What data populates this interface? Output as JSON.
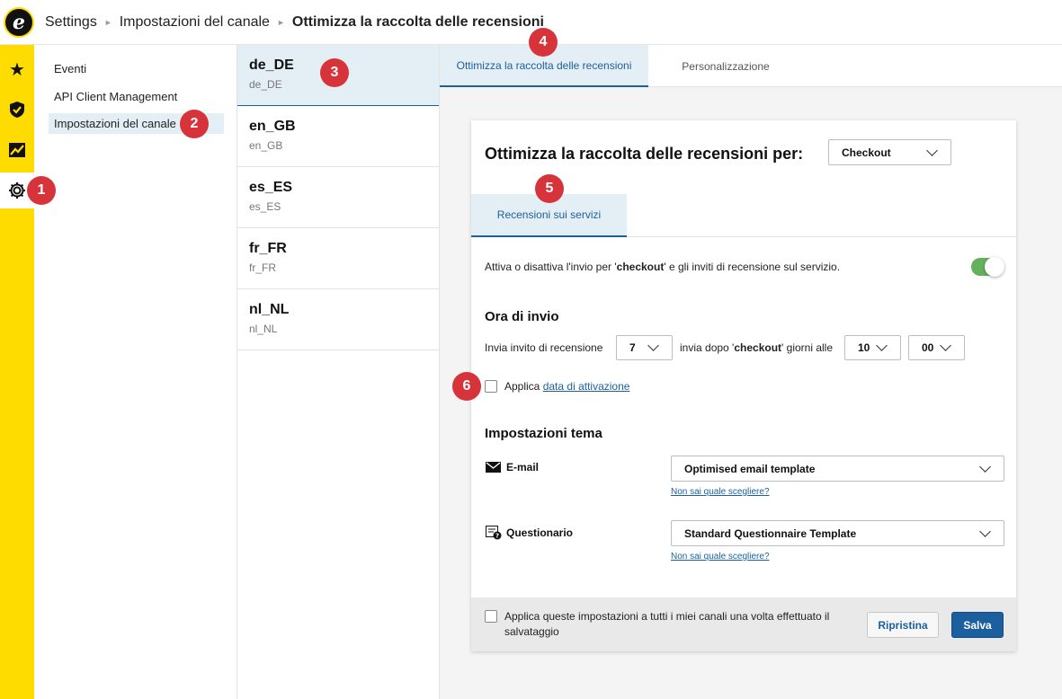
{
  "header": {
    "logo_letter": "e",
    "breadcrumb": [
      "Settings",
      "Impostazioni del canale"
    ],
    "current": "Ottimizza la raccolta delle recensioni"
  },
  "rail": {
    "icons": [
      "star-icon",
      "shield-check-icon",
      "chart-icon",
      "gear-icon"
    ]
  },
  "nav1": {
    "items": [
      "Eventi",
      "API Client Management",
      "Impostazioni del canale"
    ]
  },
  "locales": [
    {
      "code": "de_DE",
      "sub": "de_DE"
    },
    {
      "code": "en_GB",
      "sub": "en_GB"
    },
    {
      "code": "es_ES",
      "sub": "es_ES"
    },
    {
      "code": "fr_FR",
      "sub": "fr_FR"
    },
    {
      "code": "nl_NL",
      "sub": "nl_NL"
    }
  ],
  "tabs": [
    "Ottimizza la raccolta delle recensioni",
    "Personalizzazione"
  ],
  "card": {
    "title": "Ottimizza la raccolta delle recensioni per:",
    "trigger_select": "Checkout",
    "subtab": "Recensioni sui servizi",
    "toggle_text_pre": "Attiva o disattiva l'invio per '",
    "toggle_text_bold": "checkout",
    "toggle_text_post": "' e gli inviti di recensione sul servizio.",
    "toggle_on": true,
    "send_heading": "Ora di invio",
    "send_pre": "Invia invito di recensione",
    "days": "7",
    "send_mid_pre": "invia dopo '",
    "send_mid_bold": "checkout",
    "send_mid_post": "' giorni alle",
    "hour": "10",
    "minute": "00",
    "apply_pre": "Applica",
    "apply_link": "data di attivazione",
    "theme_heading": "Impostazioni tema",
    "email_label": "E-mail",
    "email_template": "Optimised email template",
    "help_link": "Non sai quale scegliere?",
    "questionnaire_label": "Questionario",
    "questionnaire_template": "Standard Questionnaire Template",
    "footer_text_1": "Applica queste impostazioni a tutti i miei canali una volta effettuato il",
    "footer_text_2": "salvataggio",
    "reset": "Ripristina",
    "save": "Salva"
  },
  "badges": [
    "1",
    "2",
    "3",
    "4",
    "5",
    "6"
  ],
  "colors": {
    "accent": "#1c5f9e",
    "rail": "#ffdc00",
    "badge": "#d7333a",
    "toggle": "#63b15c",
    "selected": "#e4eef5"
  }
}
